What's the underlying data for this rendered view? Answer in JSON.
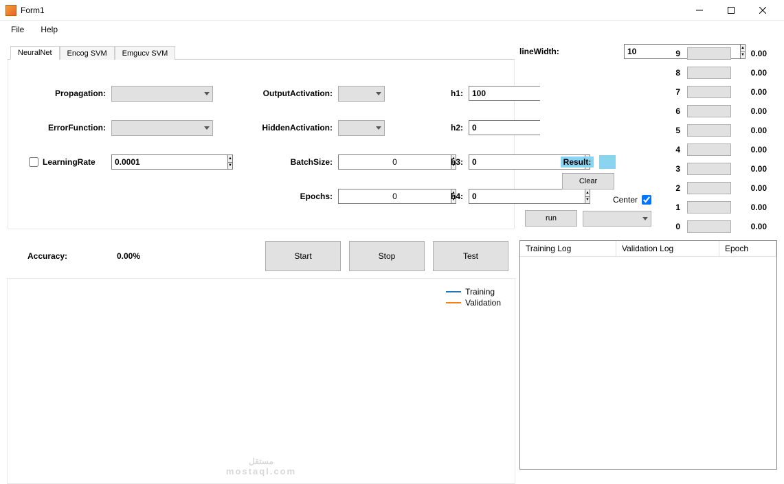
{
  "window": {
    "title": "Form1"
  },
  "menu": {
    "file": "File",
    "help": "Help"
  },
  "tabs": {
    "t0": "NeuralNet",
    "t1": "Encog SVM",
    "t2": "Emgucv SVM"
  },
  "form": {
    "propagation_label": "Propagation:",
    "error_label": "ErrorFunction:",
    "learning_label": "LearningRate",
    "learning_value": "0.0001",
    "output_act_label": "OutputActivation:",
    "hidden_act_label": "HiddenActivation:",
    "batch_label": "BatchSize:",
    "batch_value": "0",
    "epochs_label": "Epochs:",
    "epochs_value": "0",
    "h1_label": "h1:",
    "h1_value": "100",
    "h2_label": "h2:",
    "h2_value": "0",
    "h3_label": "h3:",
    "h3_value": "0",
    "h4_label": "h4:",
    "h4_value": "0"
  },
  "accuracy": {
    "label": "Accuracy:",
    "value": "0.00%"
  },
  "buttons": {
    "start": "Start",
    "stop": "Stop",
    "test": "Test",
    "clear": "Clear",
    "run": "run"
  },
  "legend": {
    "training": "Training",
    "validation": "Validation"
  },
  "right": {
    "linewidth_label": "lineWidth:",
    "linewidth_value": "10",
    "result_label": "Result:",
    "center_label": "Center"
  },
  "digits": {
    "d9": {
      "n": "9",
      "v": "0.00"
    },
    "d8": {
      "n": "8",
      "v": "0.00"
    },
    "d7": {
      "n": "7",
      "v": "0.00"
    },
    "d6": {
      "n": "6",
      "v": "0.00"
    },
    "d5": {
      "n": "5",
      "v": "0.00"
    },
    "d4": {
      "n": "4",
      "v": "0.00"
    },
    "d3": {
      "n": "3",
      "v": "0.00"
    },
    "d2": {
      "n": "2",
      "v": "0.00"
    },
    "d1": {
      "n": "1",
      "v": "0.00"
    },
    "d0": {
      "n": "0",
      "v": "0.00"
    }
  },
  "log": {
    "c1": "Training Log",
    "c2": "Validation Log",
    "c3": "Epoch"
  },
  "watermark": {
    "main": "مستقل",
    "sub": "mostaql.com"
  }
}
